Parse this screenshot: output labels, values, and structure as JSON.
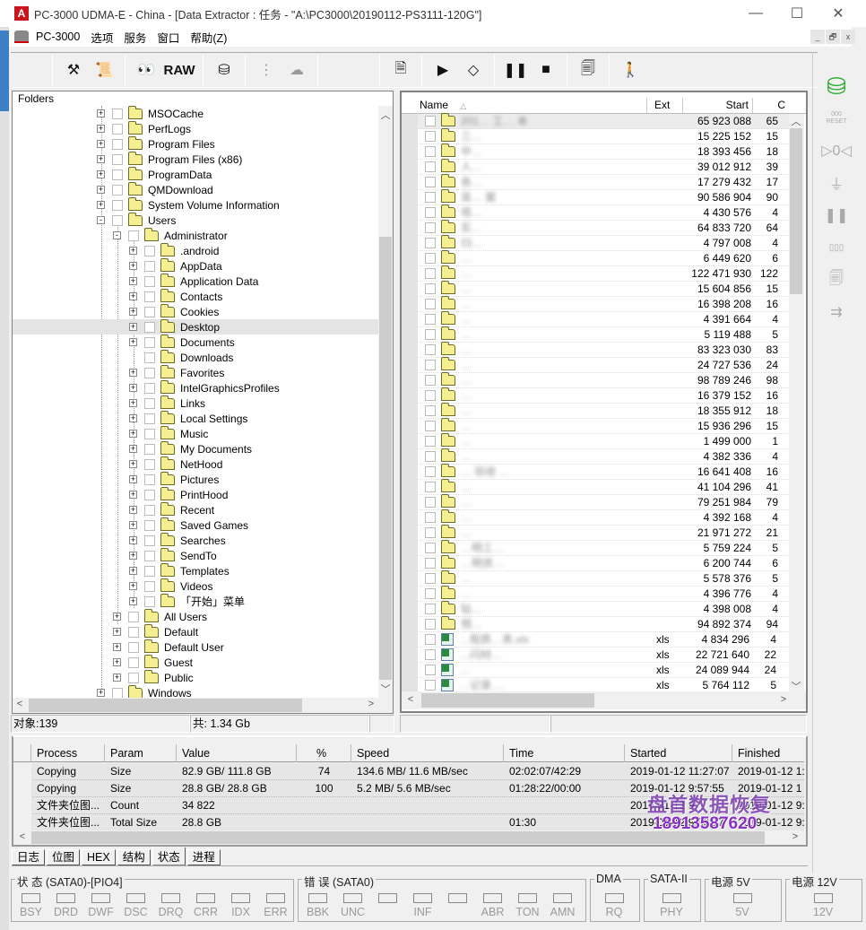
{
  "window": {
    "title": "PC-3000 UDMA-E - China - [Data Extractor : 任务 - \"A:\\PC3000\\20190112-PS3111-120G\"]",
    "app_icon": "pc3000-logo-icon",
    "controls": {
      "minimize": "—",
      "maximize": "☐",
      "close": "✕"
    }
  },
  "menubar": {
    "items": [
      "PC-3000",
      "选项",
      "服务",
      "窗口",
      "帮助(Z)"
    ],
    "mdi_controls": [
      "_",
      "🗗",
      "x"
    ]
  },
  "toolbar": {
    "buttons": [
      {
        "name": "tools-icon",
        "glyph": "⚒",
        "disabled": false
      },
      {
        "name": "info-scroll-icon",
        "glyph": "📜",
        "disabled": false
      },
      {
        "name": "binoculars-icon",
        "glyph": "👀",
        "disabled": false
      },
      {
        "name": "raw-button",
        "label": "RAW",
        "disabled": false
      },
      {
        "name": "disk-filter-icon",
        "glyph": "⛁",
        "disabled": false
      },
      {
        "name": "tree-list-icon",
        "glyph": "⋮",
        "disabled": true
      },
      {
        "name": "tree-cloud-icon",
        "glyph": "☁",
        "disabled": true
      },
      {
        "name": "document-check-icon",
        "glyph": "🗎",
        "disabled": false
      },
      {
        "name": "play-icon",
        "glyph": "▶",
        "disabled": false
      },
      {
        "name": "flowchart-icon",
        "glyph": "◇",
        "disabled": false
      },
      {
        "name": "pause-icon",
        "glyph": "❚❚",
        "disabled": false
      },
      {
        "name": "stop-icon",
        "glyph": "■",
        "disabled": false
      },
      {
        "name": "windows-icon",
        "glyph": "🗐",
        "disabled": false
      },
      {
        "name": "exit-icon",
        "glyph": "🚶",
        "disabled": false
      }
    ]
  },
  "right_toolbar": [
    {
      "name": "database-swap-icon",
      "glyph": "⛁",
      "active": true
    },
    {
      "name": "reset-counter-icon",
      "glyph": "000",
      "label": "RESET",
      "active": false
    },
    {
      "name": "measure-icon",
      "glyph": "▷0◁",
      "active": false
    },
    {
      "name": "power-switch-icon",
      "glyph": "⏚",
      "active": false
    },
    {
      "name": "pause-icon",
      "glyph": "❚❚",
      "active": false
    },
    {
      "name": "counter-clear-icon",
      "glyph": "▯▯▯",
      "active": false
    },
    {
      "name": "copy-clear-icon",
      "glyph": "🗐",
      "active": false
    },
    {
      "name": "connector-icon",
      "glyph": "⇉",
      "active": false
    }
  ],
  "folders": {
    "header": "Folders",
    "items": [
      {
        "label": "MSOCache",
        "level": 0,
        "expander": "+"
      },
      {
        "label": "PerfLogs",
        "level": 0,
        "expander": "+"
      },
      {
        "label": "Program Files",
        "level": 0,
        "expander": "+"
      },
      {
        "label": "Program Files (x86)",
        "level": 0,
        "expander": "+"
      },
      {
        "label": "ProgramData",
        "level": 0,
        "expander": "+"
      },
      {
        "label": "QMDownload",
        "level": 0,
        "expander": "+"
      },
      {
        "label": "System Volume Information",
        "level": 0,
        "expander": "+"
      },
      {
        "label": "Users",
        "level": 0,
        "expander": "-"
      },
      {
        "label": "Administrator",
        "level": 1,
        "expander": "-"
      },
      {
        "label": ".android",
        "level": 2,
        "expander": "+"
      },
      {
        "label": "AppData",
        "level": 2,
        "expander": "+"
      },
      {
        "label": "Application Data",
        "level": 2,
        "expander": "+"
      },
      {
        "label": "Contacts",
        "level": 2,
        "expander": "+"
      },
      {
        "label": "Cookies",
        "level": 2,
        "expander": "+"
      },
      {
        "label": "Desktop",
        "level": 2,
        "expander": "+",
        "selected": true
      },
      {
        "label": "Documents",
        "level": 2,
        "expander": "+"
      },
      {
        "label": "Downloads",
        "level": 2,
        "expander": ""
      },
      {
        "label": "Favorites",
        "level": 2,
        "expander": "+"
      },
      {
        "label": "IntelGraphicsProfiles",
        "level": 2,
        "expander": "+"
      },
      {
        "label": "Links",
        "level": 2,
        "expander": "+"
      },
      {
        "label": "Local Settings",
        "level": 2,
        "expander": "+"
      },
      {
        "label": "Music",
        "level": 2,
        "expander": "+"
      },
      {
        "label": "My Documents",
        "level": 2,
        "expander": "+"
      },
      {
        "label": "NetHood",
        "level": 2,
        "expander": "+"
      },
      {
        "label": "Pictures",
        "level": 2,
        "expander": "+"
      },
      {
        "label": "PrintHood",
        "level": 2,
        "expander": "+"
      },
      {
        "label": "Recent",
        "level": 2,
        "expander": "+"
      },
      {
        "label": "Saved Games",
        "level": 2,
        "expander": "+"
      },
      {
        "label": "Searches",
        "level": 2,
        "expander": "+"
      },
      {
        "label": "SendTo",
        "level": 2,
        "expander": "+"
      },
      {
        "label": "Templates",
        "level": 2,
        "expander": "+"
      },
      {
        "label": "Videos",
        "level": 2,
        "expander": "+"
      },
      {
        "label": "「开始」菜单",
        "level": 2,
        "expander": "+"
      },
      {
        "label": "All Users",
        "level": 1,
        "expander": "+"
      },
      {
        "label": "Default",
        "level": 1,
        "expander": "+"
      },
      {
        "label": "Default User",
        "level": 1,
        "expander": "+"
      },
      {
        "label": "Guest",
        "level": 1,
        "expander": "+"
      },
      {
        "label": "Public",
        "level": 1,
        "expander": "+"
      },
      {
        "label": "Windows",
        "level": 0,
        "expander": "+"
      }
    ],
    "status": {
      "objects": "对象:139",
      "total": "共:  1.34 Gb"
    }
  },
  "file_list": {
    "columns": [
      "Name",
      "Ext",
      "Start",
      "C"
    ],
    "sort_indicator": "△",
    "rows": [
      {
        "name": "201… 工… 本",
        "type": "folder",
        "ext": "",
        "start": "65 923 088",
        "c": "65",
        "highlight": true
      },
      {
        "name": "三…",
        "type": "folder",
        "ext": "",
        "start": "15 225 152",
        "c": "15"
      },
      {
        "name": "中…",
        "type": "folder",
        "ext": "",
        "start": "18 393 456",
        "c": "18"
      },
      {
        "name": "人…",
        "type": "folder",
        "ext": "",
        "start": "39 012 912",
        "c": "39"
      },
      {
        "name": "各…",
        "type": "folder",
        "ext": "",
        "start": "17 279 432",
        "c": "17"
      },
      {
        "name": "吴… 案",
        "type": "folder",
        "ext": "",
        "start": "90 586 904",
        "c": "90"
      },
      {
        "name": "塔…",
        "type": "folder",
        "ext": "",
        "start": "4 430 576",
        "c": "4"
      },
      {
        "name": "实…",
        "type": "folder",
        "ext": "",
        "start": "64 833 720",
        "c": "64"
      },
      {
        "name": "归…",
        "type": "folder",
        "ext": "",
        "start": "4 797 008",
        "c": "4"
      },
      {
        "name": "…",
        "type": "folder",
        "ext": "",
        "start": "6 449 620",
        "c": "6"
      },
      {
        "name": "…",
        "type": "folder",
        "ext": "",
        "start": "122 471 930",
        "c": "122"
      },
      {
        "name": "…",
        "type": "folder",
        "ext": "",
        "start": "15 604 856",
        "c": "15"
      },
      {
        "name": "…",
        "type": "folder",
        "ext": "",
        "start": "16 398 208",
        "c": "16"
      },
      {
        "name": "…",
        "type": "folder",
        "ext": "",
        "start": "4 391 664",
        "c": "4"
      },
      {
        "name": "…",
        "type": "folder",
        "ext": "",
        "start": "5 119 488",
        "c": "5"
      },
      {
        "name": "…",
        "type": "folder",
        "ext": "",
        "start": "83 323 030",
        "c": "83"
      },
      {
        "name": "…",
        "type": "folder",
        "ext": "",
        "start": "24 727 536",
        "c": "24"
      },
      {
        "name": "…",
        "type": "folder",
        "ext": "",
        "start": "98 789 246",
        "c": "98"
      },
      {
        "name": "…",
        "type": "folder",
        "ext": "",
        "start": "16 379 152",
        "c": "16"
      },
      {
        "name": "…",
        "type": "folder",
        "ext": "",
        "start": "18 355 912",
        "c": "18"
      },
      {
        "name": "…",
        "type": "folder",
        "ext": "",
        "start": "15 936 296",
        "c": "15"
      },
      {
        "name": "…",
        "type": "folder",
        "ext": "",
        "start": "1 499 000",
        "c": "1"
      },
      {
        "name": "…",
        "type": "folder",
        "ext": "",
        "start": "4 382 336",
        "c": "4"
      },
      {
        "name": "… 验收 …",
        "type": "folder",
        "ext": "",
        "start": "16 641 408",
        "c": "16"
      },
      {
        "name": "…",
        "type": "folder",
        "ext": "",
        "start": "41 104 296",
        "c": "41"
      },
      {
        "name": "…",
        "type": "folder",
        "ext": "",
        "start": "79 251 984",
        "c": "79"
      },
      {
        "name": "…",
        "type": "folder",
        "ext": "",
        "start": "4 392 168",
        "c": "4"
      },
      {
        "name": "…",
        "type": "folder",
        "ext": "",
        "start": "21 971 272",
        "c": "21"
      },
      {
        "name": "…明工…",
        "type": "folder",
        "ext": "",
        "start": "5 759 224",
        "c": "5"
      },
      {
        "name": "…明资…",
        "type": "folder",
        "ext": "",
        "start": "6 200 744",
        "c": "6"
      },
      {
        "name": "…",
        "type": "folder",
        "ext": "",
        "start": "5 578 376",
        "c": "5"
      },
      {
        "name": "…",
        "type": "folder",
        "ext": "",
        "start": "4 396 776",
        "c": "4"
      },
      {
        "name": "钻…",
        "type": "folder",
        "ext": "",
        "start": "4 398 008",
        "c": "4"
      },
      {
        "name": "预…",
        "type": "folder",
        "ext": "",
        "start": "94 892 374",
        "c": "94"
      },
      {
        "name": "…程质…表.xls",
        "type": "xls",
        "ext": "xls",
        "start": "4 834 296",
        "c": "4"
      },
      {
        "name": "…闪材…",
        "type": "xls",
        "ext": "xls",
        "start": "22 721 640",
        "c": "22"
      },
      {
        "name": "…",
        "type": "xls",
        "ext": "xls",
        "start": "24 089 944",
        "c": "24"
      },
      {
        "name": "…记录….",
        "type": "xls",
        "ext": "xls",
        "start": "5 764 112",
        "c": "5"
      }
    ]
  },
  "process_table": {
    "columns": [
      "Process",
      "Param",
      "Value",
      "%",
      "Speed",
      "Time",
      "Started",
      "Finished"
    ],
    "rows": [
      {
        "process": "Copying",
        "param": "Size",
        "value": "82.9 GB/ 111.8 GB",
        "pct": "74",
        "speed": "134.6 MB/ 11.6 MB/sec",
        "time": "02:02:07/42:29",
        "started": "2019-01-12 11:27:07",
        "finished": "2019-01-12 1:"
      },
      {
        "process": "Copying",
        "param": "Size",
        "value": "28.8 GB/ 28.8 GB",
        "pct": "100",
        "speed": "5.2 MB/ 5.6 MB/sec",
        "time": "01:28:22/00:00",
        "started": "2019-01-12 9:57:55",
        "finished": "2019-01-12 1"
      },
      {
        "process": "文件夹位图...",
        "param": "Count",
        "value": "34 822",
        "pct": "",
        "speed": "",
        "time": "",
        "started": "2019-01-12 9:",
        "finished": "2019-01-12 9:"
      },
      {
        "process": "文件夹位图...",
        "param": "Total Size",
        "value": "28.8 GB",
        "pct": "",
        "speed": "",
        "time": "01:30",
        "started": "2019-01-12 9:56:17",
        "finished": "2019-01-12 9:"
      }
    ]
  },
  "bottom_tabs": {
    "items": [
      "日志",
      "位图",
      "HEX",
      "结构",
      "状态",
      "进程"
    ],
    "active": "状态"
  },
  "watermark": {
    "line1": "盘首数据恢复",
    "line2": "18913587620"
  },
  "indicators": {
    "status_group": {
      "label": "状 态 (SATA0)-[PIO4]",
      "leds": [
        "BSY",
        "DRD",
        "DWF",
        "DSC",
        "DRQ",
        "CRR",
        "IDX",
        "ERR"
      ]
    },
    "error_group": {
      "label": "错 误 (SATA0)",
      "leds": [
        "BBK",
        "UNC",
        "",
        "INF",
        "",
        "ABR",
        "TON",
        "AMN"
      ]
    },
    "dma_group": {
      "label": "DMA",
      "leds": [
        "RQ"
      ]
    },
    "sata_group": {
      "label": "SATA-II",
      "leds": [
        "PHY"
      ]
    },
    "power5_group": {
      "label": "电源 5V",
      "leds": [
        "5V"
      ]
    },
    "power12_group": {
      "label": "电源 12V",
      "leds": [
        "12V"
      ]
    }
  }
}
